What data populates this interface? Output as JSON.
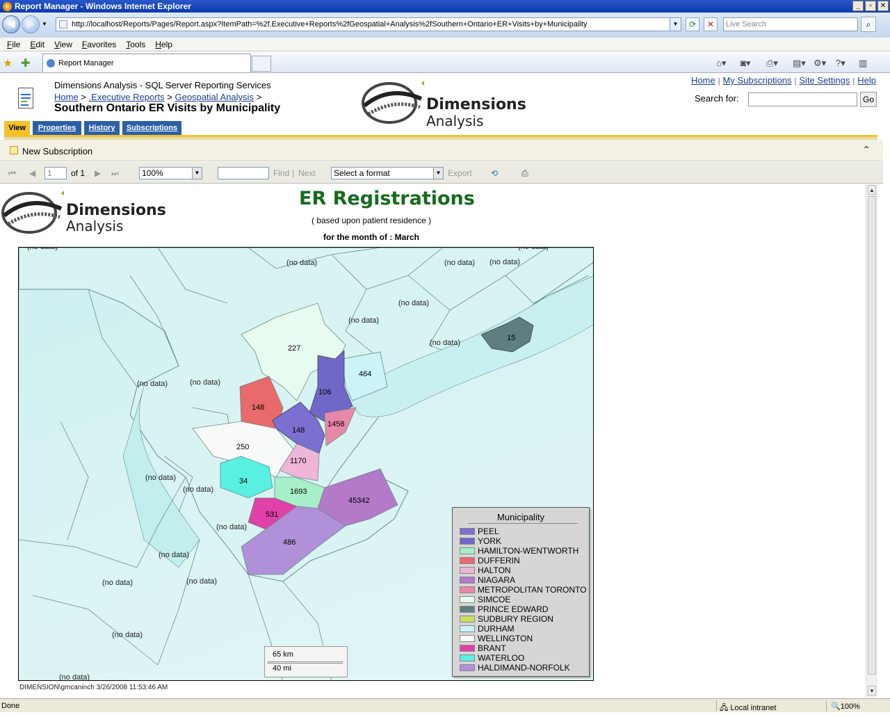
{
  "window": {
    "title": "Report Manager - Windows Internet Explorer",
    "minimize": "_",
    "maximize": "▫",
    "close": "✕"
  },
  "browser": {
    "url": "http://localhost/Reports/Pages/Report.aspx?ItemPath=%2f.Executive+Reports%2fGeospatial+Analysis%2fSouthern+Ontario+ER+Visits+by+Municipality",
    "search_placeholder": "Live Search",
    "menu": [
      "File",
      "Edit",
      "View",
      "Favorites",
      "Tools",
      "Help"
    ],
    "tab_title": "Report Manager",
    "status": "Done",
    "zone": "Local intranet",
    "zoom": "100%"
  },
  "rm": {
    "app_title": "Dimensions Analysis - SQL Server Reporting Services",
    "crumb_home": "Home",
    "crumb_exec": ".Executive Reports",
    "crumb_geo": "Geospatial Analysis",
    "sep": ">",
    "page_title": "Southern Ontario ER Visits by Municipality",
    "links": {
      "home": "Home",
      "subscriptions": "My Subscriptions",
      "settings": "Site Settings",
      "help": "Help",
      "sep": "|"
    },
    "search_label": "Search for:",
    "go": "Go",
    "tabs": [
      "View",
      "Properties",
      "History",
      "Subscriptions"
    ],
    "new_subscription": "New Subscription"
  },
  "brand": {
    "line1": "Dimensions",
    "line2": "Analysis"
  },
  "toolbar": {
    "page": "1",
    "of": "of 1",
    "zoom": "100%",
    "find": "Find",
    "bar": "|",
    "next": "Next",
    "format": "Select a format",
    "export": "Export"
  },
  "report": {
    "title": "ER Registrations",
    "subtitle": "( based upon patient residence )",
    "month": "for the month of : March",
    "footer": "DIMENSION\\gmcaninch 3/26/2008 11:53:46 AM",
    "no_data": "(no data)",
    "legend_title": "Municipality",
    "scale_km": "65 km",
    "scale_mi": "40 mi"
  },
  "chart_data": {
    "type": "choropleth-map",
    "title": "ER Registrations",
    "regions": [
      {
        "name": "PEEL",
        "value": 148,
        "color": "#7b6fd0"
      },
      {
        "name": "YORK",
        "value": 106,
        "color": "#6f68c8"
      },
      {
        "name": "HAMILTON-WENTWORTH",
        "value": 1693,
        "color": "#a6efc8"
      },
      {
        "name": "DUFFERIN",
        "value": 148,
        "color": "#e86a6a"
      },
      {
        "name": "HALTON",
        "value": 1170,
        "color": "#f0b6d8"
      },
      {
        "name": "NIAGARA",
        "value": 45342,
        "color": "#b27ac8"
      },
      {
        "name": "METROPOLITAN TORONTO",
        "value": 1458,
        "color": "#e888a8"
      },
      {
        "name": "SIMCOE",
        "value": 227,
        "color": "#e8fbf0"
      },
      {
        "name": "PRINCE EDWARD",
        "value": 15,
        "color": "#5e7e80"
      },
      {
        "name": "SUDBURY REGION",
        "value": null,
        "color": "#c8e060"
      },
      {
        "name": "DURHAM",
        "value": 464,
        "color": "#ccf3f6"
      },
      {
        "name": "WELLINGTON",
        "value": 250,
        "color": "#f8fafa"
      },
      {
        "name": "BRANT",
        "value": 531,
        "color": "#e040a8"
      },
      {
        "name": "WATERLOO",
        "value": 34,
        "color": "#58f0e0"
      },
      {
        "name": "HALDIMAND-NORFOLK",
        "value": 486,
        "color": "#b090d8"
      }
    ]
  }
}
